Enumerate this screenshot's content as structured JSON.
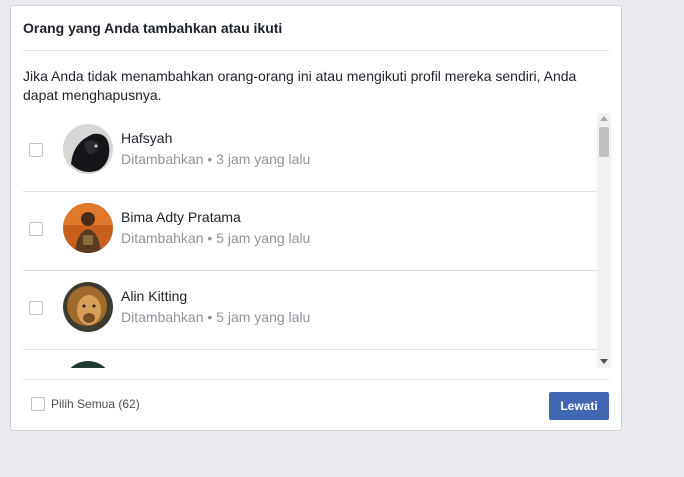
{
  "dialog": {
    "title": "Orang yang Anda tambahkan atau ikuti",
    "description": "Jika Anda tidak menambahkan orang-orang ini atau mengikuti profil mereka sendiri, Anda dapat menghapusnya."
  },
  "people": [
    {
      "name": "Hafsyah",
      "meta": "Ditambahkan • 3 jam yang lalu",
      "checked": false
    },
    {
      "name": "Bima Adty Pratama",
      "meta": "Ditambahkan • 5 jam yang lalu",
      "checked": false
    },
    {
      "name": "Alin Kitting",
      "meta": "Ditambahkan • 5 jam yang lalu",
      "checked": false
    }
  ],
  "footer": {
    "select_all_label": "Pilih Semua (62)",
    "skip_label": "Lewati"
  },
  "colors": {
    "primary_button": "#4267b2",
    "page_background": "#e9ebee",
    "secondary_text": "#90949c"
  }
}
